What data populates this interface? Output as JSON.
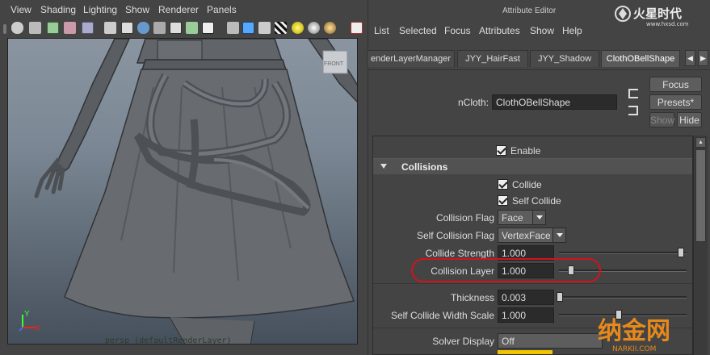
{
  "viewport": {
    "menu": [
      "View",
      "Shading",
      "Lighting",
      "Show",
      "Renderer",
      "Panels"
    ],
    "camera_label": "persp (defaultRenderLayer)",
    "viewcube_label": "FRONT",
    "axis_y": "Y",
    "axis_x": "X",
    "toolbar_icons": [
      "camera-icon",
      "camera-attr-icon",
      "bookmark-icon",
      "image-plane-icon",
      "grid-icon",
      "wireframe-icon",
      "smooth-shade-icon",
      "flat-shade-icon",
      "textured-icon",
      "lights-icon",
      "xray-icon",
      "text-icon",
      "isolate-icon",
      "cube-icon",
      "backface-icon",
      "checker-icon",
      "default-light-icon",
      "all-lights-icon",
      "shadow-icon"
    ]
  },
  "attribute_editor": {
    "title": "Attribute Editor",
    "menu": [
      "List",
      "Selected",
      "Focus",
      "Attributes",
      "Show",
      "Help"
    ],
    "tabs": [
      "enderLayerManager",
      "JYY_HairFast",
      "JYY_Shadow",
      "ClothOBellShape"
    ],
    "active_tab": 3,
    "node_label": "nCloth:",
    "node_name": "ClothOBellShape",
    "buttons": {
      "focus": "Focus",
      "presets": "Presets*",
      "show": "Show",
      "hide": "Hide"
    },
    "enable_label": "Enable",
    "section_title": "Collisions",
    "collide_label": "Collide",
    "self_collide_label": "Self Collide",
    "collision_flag": {
      "label": "Collision Flag",
      "value": "Face"
    },
    "self_collision_flag": {
      "label": "Self Collision Flag",
      "value": "VertexFace"
    },
    "collide_strength": {
      "label": "Collide Strength",
      "value": "1.000",
      "slider_fraction": 1.0
    },
    "collision_layer": {
      "label": "Collision Layer",
      "value": "1.000",
      "slider_fraction": 0.1
    },
    "thickness": {
      "label": "Thickness",
      "value": "0.003",
      "slider_fraction": 0.0
    },
    "self_collide_width_scale": {
      "label": "Self Collide Width Scale",
      "value": "1.000",
      "slider_fraction": 0.5
    },
    "solver_display": {
      "label": "Solver Display",
      "value": "Off"
    }
  },
  "watermark": {
    "top_text": "火星时代",
    "top_url": "www.hxsd.com",
    "bottom_text": "纳金网",
    "bottom_url": "NARKII.COM"
  },
  "colors": {
    "highlight": "#d4121c",
    "panel_bg": "#444444",
    "accent_tab": "#5a5a5a",
    "swatch": "#f0c400"
  }
}
